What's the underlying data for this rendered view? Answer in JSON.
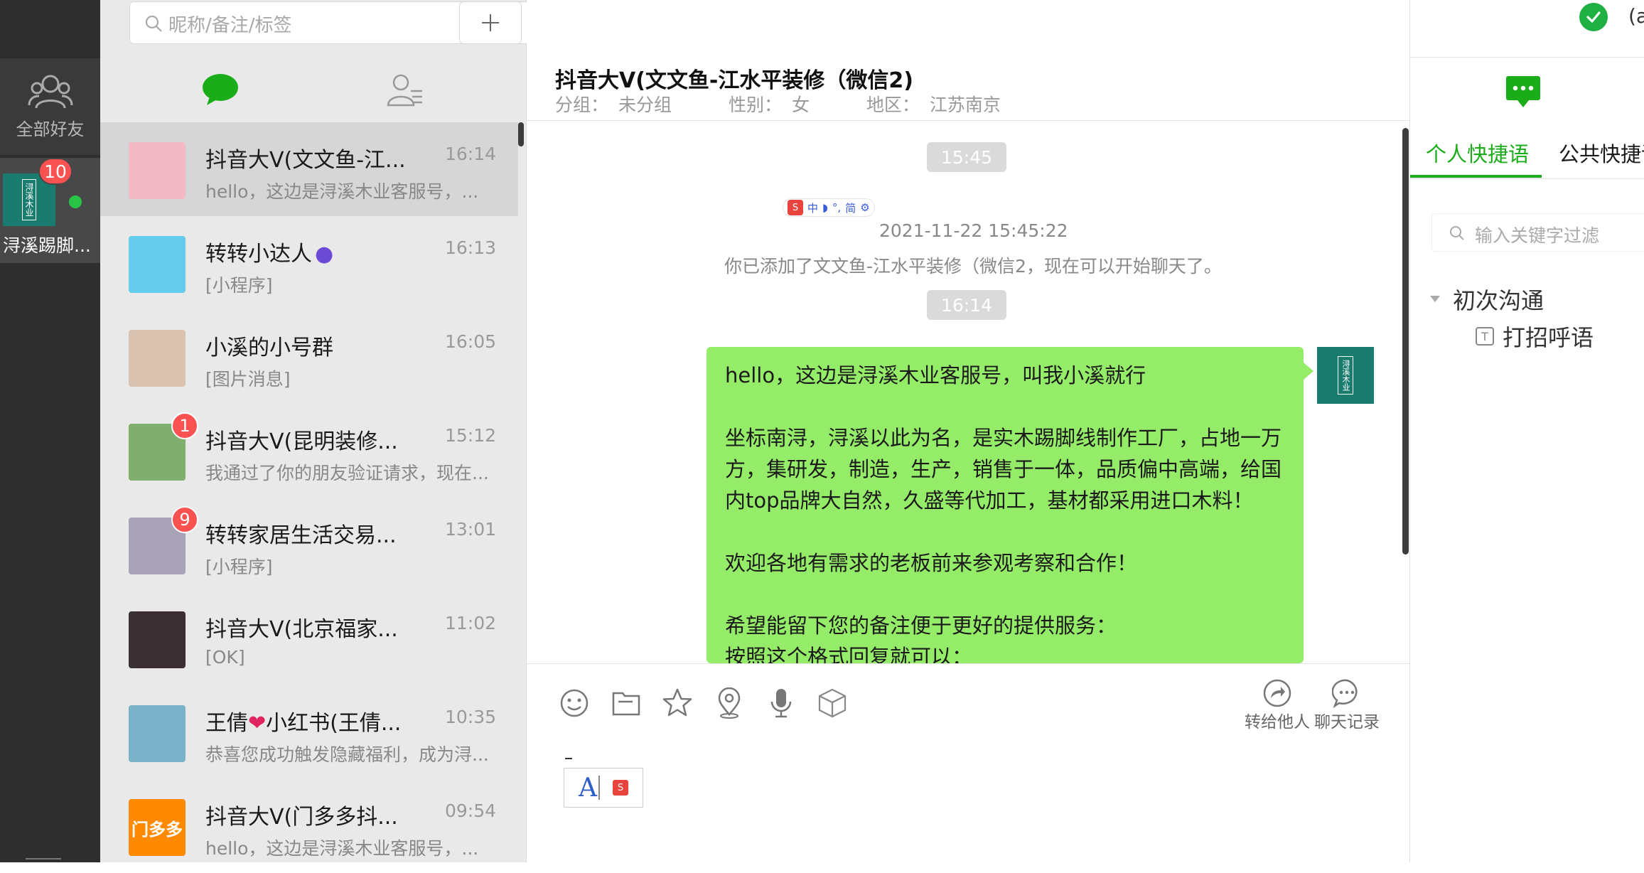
{
  "rail": {
    "friends_label": "全部好友",
    "account_name": "浔溪踢脚...",
    "account_badge": "10",
    "account_logo": "浔溪木业"
  },
  "list": {
    "search_placeholder": "昵称/备注/标签",
    "add_symbol": "+",
    "conversations": [
      {
        "name": "抖音大V(文文鱼-江...",
        "time": "16:14",
        "preview": "hello，这边是浔溪木业客服号，...",
        "active": true,
        "badge": "",
        "avatar_color": "#f2b8c6"
      },
      {
        "name": "转转小达人",
        "time": "16:13",
        "preview": "[小程序]",
        "active": false,
        "badge": "",
        "avatar_color": "#66ccee"
      },
      {
        "name": "小溪的小号群",
        "time": "16:05",
        "preview": "[图片消息]",
        "active": false,
        "badge": "",
        "avatar_color": "#d9c3b0"
      },
      {
        "name": "抖音大V(昆明装修...",
        "time": "15:12",
        "preview": "我通过了你的朋友验证请求，现在...",
        "active": false,
        "badge": "1",
        "avatar_color": "#7fae6e"
      },
      {
        "name": "转转家居生活交易...",
        "time": "13:01",
        "preview": "[小程序]",
        "active": false,
        "badge": "9",
        "avatar_color": "#a9a3b8"
      },
      {
        "name": "抖音大V(北京福家...",
        "time": "11:02",
        "preview": "[OK]",
        "active": false,
        "badge": "",
        "avatar_color": "#3b2f34"
      },
      {
        "name": "王倩",
        "name_tail": "小红书(王倩...",
        "time": "10:35",
        "preview": "恭喜您成功触发隐藏福利，成为浔...",
        "active": false,
        "badge": "",
        "avatar_color": "#7ab3c9"
      },
      {
        "name": "抖音大V(门多多抖...",
        "time": "09:54",
        "preview": "hello，这边是浔溪木业客服号，...",
        "active": false,
        "badge": "",
        "avatar_color": "#ff8a00",
        "avatar_text": "门多多"
      }
    ]
  },
  "chat": {
    "title": "抖音大V(文文鱼-江水平装修（微信2)",
    "group_label": "分组：",
    "group_value": "未分组",
    "gender_label": "性别：",
    "gender_value": "女",
    "region_label": "地区：",
    "region_value": "江苏南京",
    "time1": "15:45",
    "ime_strip": [
      "中",
      "简"
    ],
    "system_time": "2021-11-22 15:45:22",
    "system_text": "你已添加了文文鱼-江水平装修（微信2，现在可以开始聊天了。",
    "time2": "16:14",
    "message": {
      "p1": "hello，这边是浔溪木业客服号，叫我小溪就行",
      "p2": "坐标南浔，浔溪以此为名，是实木踢脚线制作工厂，占地一万方，集研发，制造，生产，销售于一体，品质偏中高端，给国内top品牌大自然，久盛等代加工，基材都采用进口木料！",
      "p3": "欢迎各地有需求的老板前来参观考察和合作！",
      "p4": "希望能留下您的备注便于更好的提供服务：",
      "p5": "按照这个格式回复就可以："
    },
    "self_logo": "浔溪木业",
    "forward_label": "转给他人",
    "history_label": "聊天记录",
    "ime_letter": "A"
  },
  "right": {
    "top_partial": "(a",
    "tab_personal": "个人快捷语",
    "tab_public": "公共快捷语",
    "filter_placeholder": "输入关键字过滤",
    "group_name": "初次沟通",
    "item_name": "打招呼语",
    "accent": "#1aad19"
  }
}
